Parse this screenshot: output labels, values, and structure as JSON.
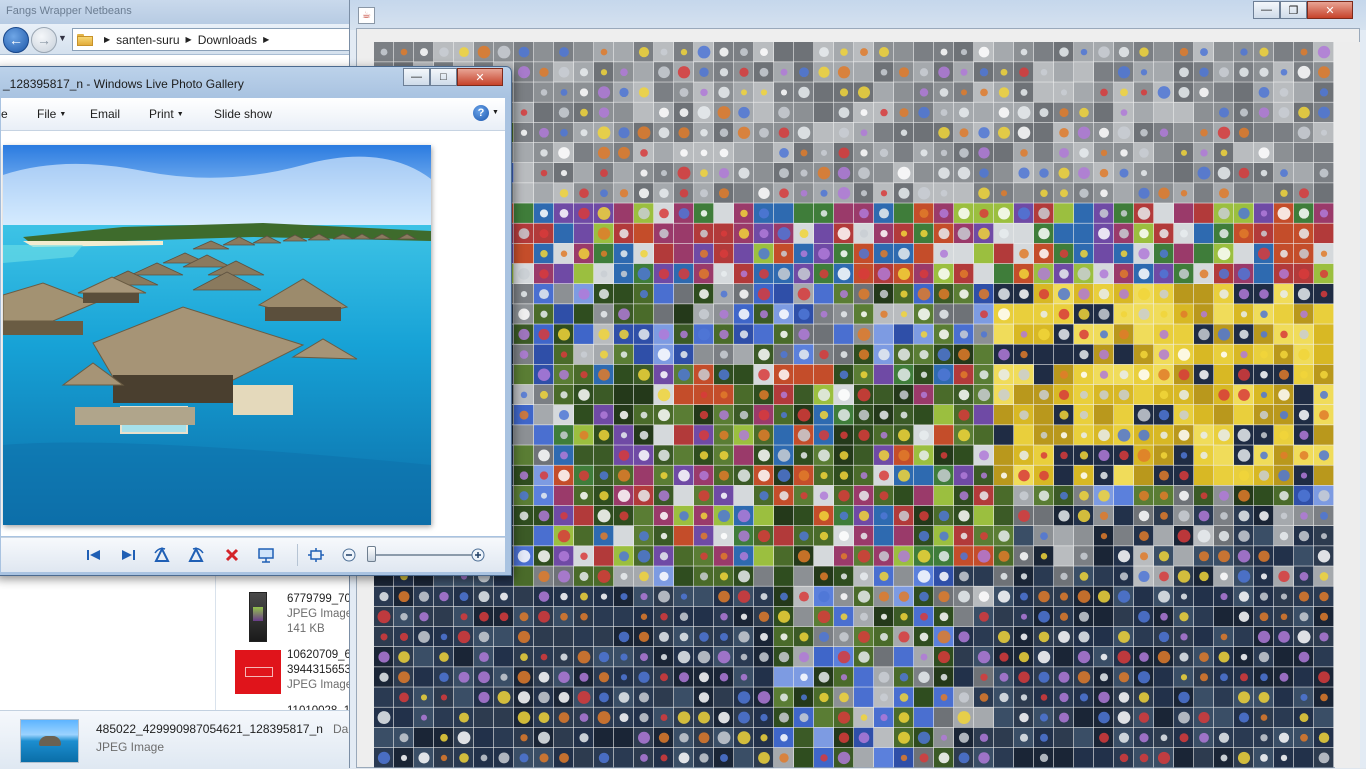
{
  "explorer": {
    "top_strip_text": "Fangs Wrapper    Netbeans",
    "breadcrumb": [
      "santen-suru",
      "Downloads"
    ],
    "files": [
      {
        "name": "6779799_70",
        "type": "JPEG Image",
        "size": "141 KB"
      },
      {
        "name": "10620709_67",
        "name2": "3944315653",
        "type": "JPEG Image"
      },
      {
        "name": "11010028_10"
      }
    ],
    "details": {
      "name": "485022_429990987054621_128395817_n",
      "type": "JPEG Image",
      "date_label": "Da"
    }
  },
  "gallery": {
    "title": "_128395817_n - Windows Live Photo Gallery",
    "menu": {
      "partial": "e",
      "file": "File",
      "email": "Email",
      "print": "Print",
      "slideshow": "Slide show"
    },
    "help_label": "?",
    "zoom_level": 0.0,
    "toolbar_icons": [
      "previous-icon",
      "next-icon",
      "rotate-left-icon",
      "rotate-right-icon",
      "delete-icon",
      "slideshow-icon",
      "actual-size-icon",
      "zoom-out-icon",
      "zoom-in-icon"
    ]
  },
  "java": {
    "icon_label": "☕",
    "mosaic_tile_count": "48x36"
  },
  "colors": {
    "accent": "#1d57a8",
    "close": "#c7432a",
    "gallery_frame": "#a9c3e1"
  }
}
